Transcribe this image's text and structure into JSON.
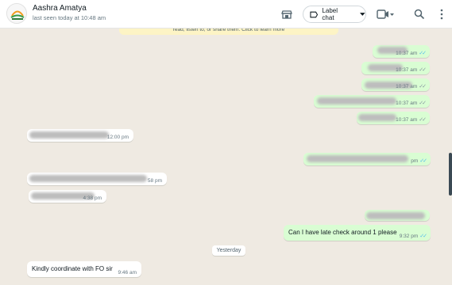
{
  "header": {
    "contact_name": "Aashra Amatya",
    "last_seen": "last seen today at 10:48 am",
    "label_chat": "Label chat"
  },
  "chat": {
    "notice_text": "read, listen to, or share them. Click to learn more",
    "date_divider": "Yesterday",
    "messages": [
      {
        "direction": "out",
        "text": "",
        "time": "10:37 am",
        "ticks": "✓✓"
      },
      {
        "direction": "out",
        "text": "",
        "time": "10:37 am",
        "ticks": "✓✓"
      },
      {
        "direction": "out",
        "text": "",
        "time": "10:37 am",
        "ticks": "✓✓"
      },
      {
        "direction": "out",
        "text": "",
        "time": "10:37 am",
        "ticks": "✓✓"
      },
      {
        "direction": "out",
        "text": "",
        "time": "10:37 am",
        "ticks": "✓✓"
      },
      {
        "direction": "in",
        "text": "",
        "time": "12:00 pm"
      },
      {
        "direction": "out",
        "text": "",
        "time": "pm",
        "ticks": "✓✓"
      },
      {
        "direction": "in",
        "text": "",
        "time": "58 pm"
      },
      {
        "direction": "in",
        "text": "",
        "time": "4:38 pm"
      },
      {
        "direction": "out",
        "text": "Can I have late check around 1 please",
        "time": "9:32 pm",
        "ticks": "✓✓"
      },
      {
        "direction": "in",
        "text": "Kindly coordinate with FO sir",
        "time": "9:46 am"
      }
    ]
  },
  "colors": {
    "outgoing_bubble": "#d9fdd3",
    "incoming_bubble": "#ffffff",
    "chat_background": "#efeae2",
    "read_ticks": "#53bdeb"
  },
  "icons": [
    "avatar-logo",
    "shop-icon",
    "label-icon",
    "caret-down-icon",
    "video-call-icon",
    "search-icon",
    "more-options-icon"
  ]
}
